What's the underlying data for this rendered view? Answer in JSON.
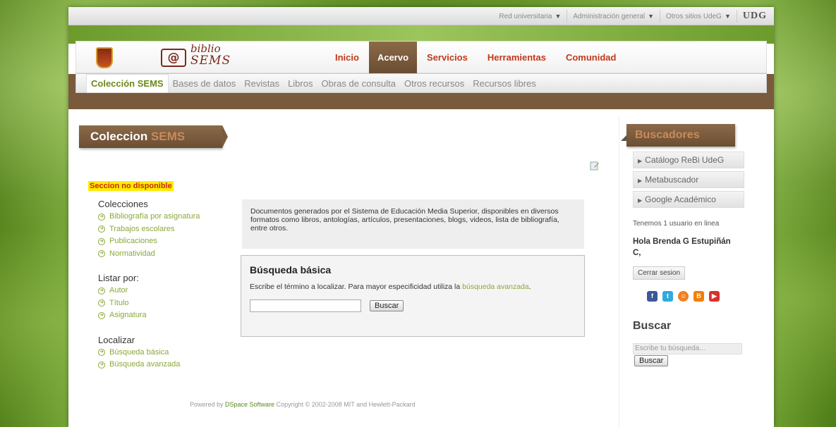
{
  "topbar": {
    "items": [
      "Red universitaria",
      "Administración general",
      "Otros sitios UdeG"
    ],
    "logo": "UDG"
  },
  "brand": {
    "at": "@",
    "line1": "biblio",
    "line2": "SEMS"
  },
  "mainnav": [
    "Inicio",
    "Acervo",
    "Servicios",
    "Herramientas",
    "Comunidad"
  ],
  "mainnav_active": "Acervo",
  "subnav": [
    "Colección SEMS",
    "Bases de datos",
    "Revistas",
    "Libros",
    "Obras de consulta",
    "Otros recursos",
    "Recursos libres"
  ],
  "title": {
    "part1": "Coleccion ",
    "part2": "SEMS"
  },
  "unavailable": "Seccion no disponible",
  "groups": [
    {
      "title": "Colecciones",
      "links": [
        "Bibliografía por asignatura",
        "Trabajos escolares",
        "Publicaciones",
        "Normatividad"
      ]
    },
    {
      "title": "Listar por:",
      "links": [
        "Autor",
        "Título",
        "Asignatura"
      ]
    },
    {
      "title": "Localizar",
      "links": [
        "Búsqueda básica",
        "Búsqueda avanzada"
      ]
    }
  ],
  "description": "Documentos generados por el Sistema de Educación Media Superior, disponibles en diversos formatos como libros, antologías, artículos, presentaciones, blogs, videos, lista de bibliografía, entre otros.",
  "basic_search": {
    "heading": "Búsqueda básica",
    "text": "Escribe el término a localizar. Para mayor especificidad utiliza la ",
    "link": "búsqueda avanzada",
    "text_end": ".",
    "input_value": "",
    "button": "Buscar"
  },
  "footer": {
    "pre": "Powered by ",
    "link": "DSpace Software",
    "post": " Copyright © 2002-2008 MIT and Hewlett-Packard"
  },
  "right": {
    "tab": "Buscadores",
    "links": [
      "Catálogo ReBi UdeG",
      "Metabuscador",
      "Google Académico"
    ],
    "online": "Tenemos 1 usuario en linea",
    "hello": "Hola Brenda G Estupiñán C,",
    "logout": "Cerrar sesion",
    "social_icons": [
      "facebook-icon",
      "twitter-icon",
      "messenger-icon",
      "blogger-icon",
      "youtube-icon"
    ],
    "buscar_heading": "Buscar",
    "search_placeholder": "Escribe tu búsqueda...",
    "search_button": "Buscar"
  }
}
